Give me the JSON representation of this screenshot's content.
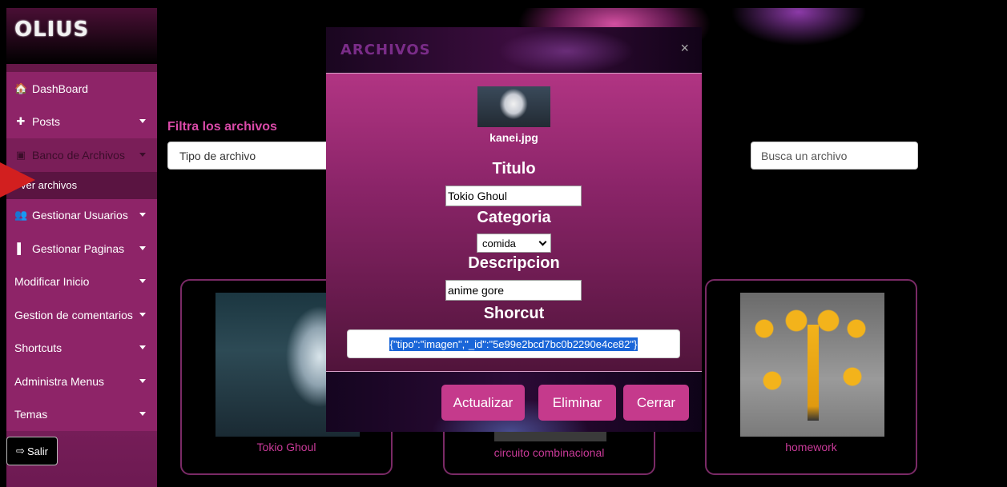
{
  "sidebar": {
    "logo": "OLIUS",
    "items": [
      {
        "label": "DashBoard",
        "icon": "home-icon",
        "glyph": "🏠",
        "caret": false,
        "dim": false
      },
      {
        "label": "Posts",
        "icon": "plus-icon",
        "glyph": "✚",
        "caret": true,
        "dim": false
      },
      {
        "label": "Banco de Archivos",
        "icon": "image-icon",
        "glyph": "▣",
        "caret": true,
        "dim": true
      }
    ],
    "sub_item": "ver archivos",
    "items2": [
      {
        "label": "Gestionar Usuarios",
        "icon": "users-icon",
        "glyph": "👥",
        "caret": true
      },
      {
        "label": "Gestionar Paginas",
        "icon": "file-icon",
        "glyph": "▌",
        "caret": true
      },
      {
        "label": "Modificar Inicio",
        "caret": true
      },
      {
        "label": "Gestion de comentarios",
        "caret": true
      },
      {
        "label": "Shortcuts",
        "caret": true
      },
      {
        "label": "Administra Menus",
        "caret": true
      },
      {
        "label": "Temas",
        "caret": true
      }
    ],
    "logout_label": "Salir"
  },
  "filter": {
    "title": "Filtra los archivos",
    "type_select": "Tipo de archivo",
    "search_placeholder": "Busca un archivo"
  },
  "cards": [
    {
      "caption": "Tokio Ghoul"
    },
    {
      "caption": "circuito combinacional"
    },
    {
      "caption": "homework"
    }
  ],
  "modal": {
    "title": "ARCHIVOS",
    "close": "×",
    "filename": "kanei.jpg",
    "titulo_label": "Titulo",
    "titulo_value": "Tokio Ghoul",
    "categoria_label": "Categoria",
    "categoria_value": "comida",
    "descripcion_label": "Descripcion",
    "descripcion_value": "anime gore",
    "shortcut_label": "Shorcut",
    "shortcut_value": "{\"tipo\":\"imagen\",\"_id\":\"5e99e2bcd7bc0b2290e4ce82\"}",
    "buttons": {
      "update": "Actualizar",
      "delete": "Eliminar",
      "close": "Cerrar"
    }
  },
  "colors": {
    "accent": "#c53a8c",
    "sidebar": "#8e2468",
    "highlight": "#1a66d8"
  }
}
